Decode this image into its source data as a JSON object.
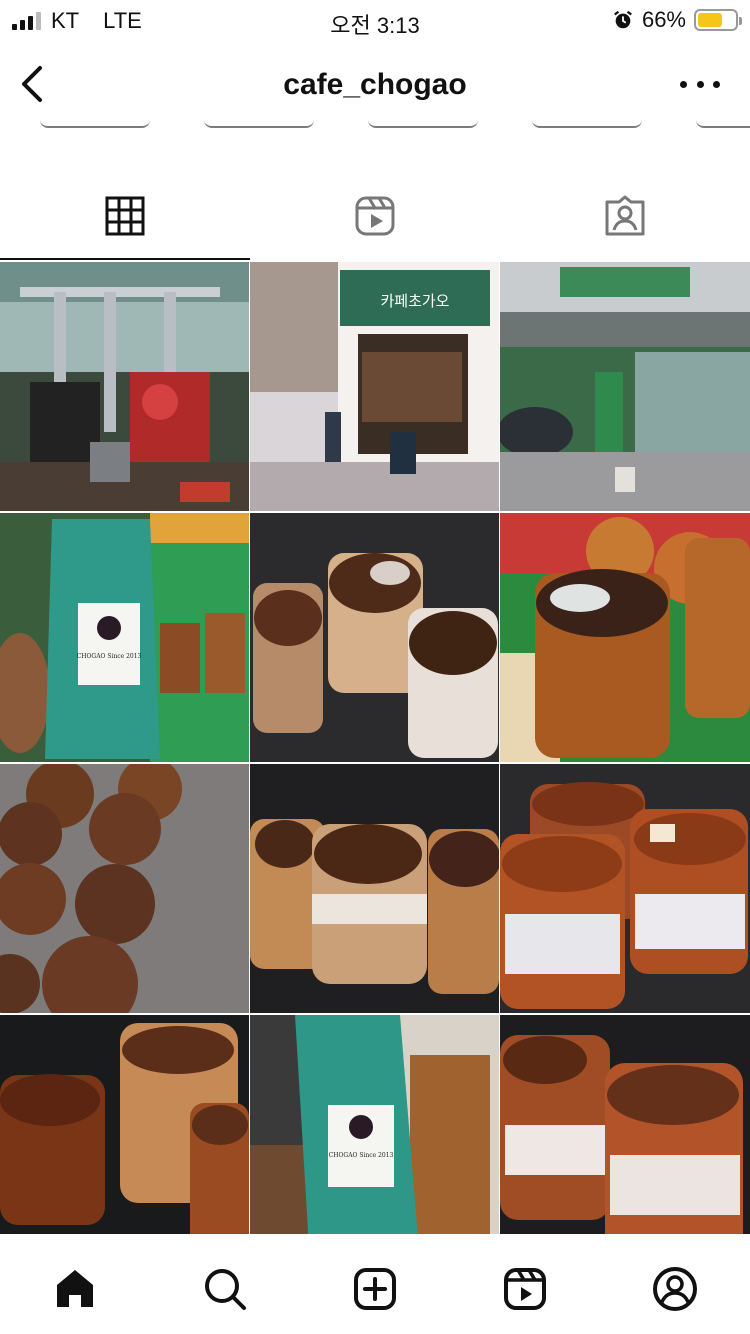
{
  "status_bar": {
    "carrier": "KT",
    "network": "LTE",
    "time": "오전 3:13",
    "battery_percent": "66%",
    "battery_level": 0.66,
    "battery_color": "#f5c518"
  },
  "header": {
    "title": "cafe_chogao"
  },
  "tabs": [
    {
      "icon": "grid-icon",
      "active": true
    },
    {
      "icon": "reels-icon",
      "active": false
    },
    {
      "icon": "tagged-icon",
      "active": false
    }
  ],
  "posts": [
    {
      "scene": "coffee-roaster-room"
    },
    {
      "scene": "cafe-storefront",
      "sign_text": "카페초가오"
    },
    {
      "scene": "cafe-exterior-street"
    },
    {
      "scene": "coffee-bean-bag",
      "label_text": "CHOGAO Since 2013"
    },
    {
      "scene": "iced-drinks-three"
    },
    {
      "scene": "iced-drinks-with-bread"
    },
    {
      "scene": "cups-many-topdown"
    },
    {
      "scene": "iced-drinks-row"
    },
    {
      "scene": "iced-drinks-marshmallow"
    },
    {
      "scene": "iced-drinks-cluster"
    },
    {
      "scene": "coffee-bean-bag-2",
      "label_text": "CHOGAO Since 2013"
    },
    {
      "scene": "iced-drinks-pair"
    }
  ],
  "bottom_nav": [
    {
      "icon": "home-icon"
    },
    {
      "icon": "search-icon"
    },
    {
      "icon": "create-icon"
    },
    {
      "icon": "reels-icon"
    },
    {
      "icon": "profile-icon"
    }
  ]
}
